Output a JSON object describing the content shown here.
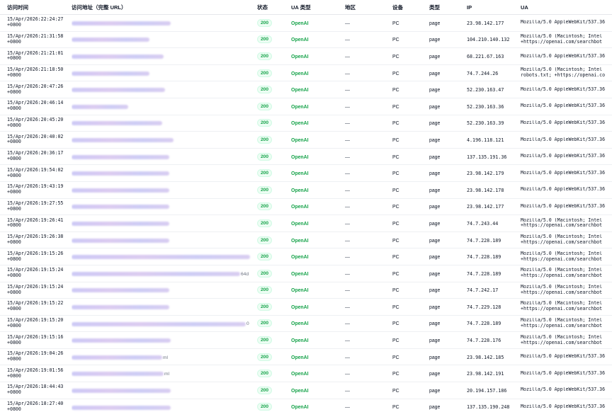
{
  "headers": {
    "time": "访问时间",
    "url": "访问地址（完整 URL）",
    "status": "状态",
    "ua_type": "UA 类型",
    "region": "地区",
    "device": "设备",
    "type": "类型",
    "ip": "IP",
    "ua": "UA"
  },
  "rows": [
    {
      "time1": "15/Apr/2026:22:24:27",
      "time2": "+0800",
      "url_blur_len": 140,
      "url_tail": "",
      "status": "200",
      "ua_type": "OpenAI",
      "region": "—",
      "device": "PC",
      "type": "page",
      "ip": "23.98.142.177",
      "ua1": "Mozilla/5.0 AppleWebKit/537.36",
      "ua2": ""
    },
    {
      "time1": "15/Apr/2026:21:31:58",
      "time2": "+0800",
      "url_blur_len": 110,
      "url_tail": "",
      "status": "200",
      "ua_type": "OpenAI",
      "region": "—",
      "device": "PC",
      "type": "page",
      "ip": "104.210.140.132",
      "ua1": "Mozilla/5.0 (Macintosh; Intel",
      "ua2": "+https://openai.com/searchbot"
    },
    {
      "time1": "15/Apr/2026:21:21:01",
      "time2": "+0800",
      "url_blur_len": 130,
      "url_tail": "",
      "status": "200",
      "ua_type": "OpenAI",
      "region": "—",
      "device": "PC",
      "type": "page",
      "ip": "68.221.67.163",
      "ua1": "Mozilla/5.0 AppleWebKit/537.36",
      "ua2": ""
    },
    {
      "time1": "15/Apr/2026:21:18:50",
      "time2": "+0800",
      "url_blur_len": 110,
      "url_tail": "",
      "status": "200",
      "ua_type": "OpenAI",
      "region": "—",
      "device": "PC",
      "type": "page",
      "ip": "74.7.244.26",
      "ua1": "Mozilla/5.0 (Macintosh; Intel",
      "ua2": "robots.txt; +https://openai.co"
    },
    {
      "time1": "15/Apr/2026:20:47:26",
      "time2": "+0800",
      "url_blur_len": 132,
      "url_tail": "",
      "status": "200",
      "ua_type": "OpenAI",
      "region": "—",
      "device": "PC",
      "type": "page",
      "ip": "52.230.163.47",
      "ua1": "Mozilla/5.0 AppleWebKit/537.36",
      "ua2": ""
    },
    {
      "time1": "15/Apr/2026:20:46:14",
      "time2": "+0800",
      "url_blur_len": 80,
      "url_tail": "",
      "status": "200",
      "ua_type": "OpenAI",
      "region": "—",
      "device": "PC",
      "type": "page",
      "ip": "52.230.163.36",
      "ua1": "Mozilla/5.0 AppleWebKit/537.36",
      "ua2": ""
    },
    {
      "time1": "15/Apr/2026:20:45:20",
      "time2": "+0800",
      "url_blur_len": 128,
      "url_tail": "",
      "status": "200",
      "ua_type": "OpenAI",
      "region": "—",
      "device": "PC",
      "type": "page",
      "ip": "52.230.163.39",
      "ua1": "Mozilla/5.0 AppleWebKit/537.36",
      "ua2": ""
    },
    {
      "time1": "15/Apr/2026:20:40:02",
      "time2": "+0800",
      "url_blur_len": 144,
      "url_tail": "",
      "status": "200",
      "ua_type": "OpenAI",
      "region": "—",
      "device": "PC",
      "type": "page",
      "ip": "4.196.118.121",
      "ua1": "Mozilla/5.0 AppleWebKit/537.36",
      "ua2": ""
    },
    {
      "time1": "15/Apr/2026:20:36:17",
      "time2": "+0800",
      "url_blur_len": 138,
      "url_tail": "",
      "status": "200",
      "ua_type": "OpenAI",
      "region": "—",
      "device": "PC",
      "type": "page",
      "ip": "137.135.191.36",
      "ua1": "Mozilla/5.0 AppleWebKit/537.36",
      "ua2": ""
    },
    {
      "time1": "15/Apr/2026:19:54:02",
      "time2": "+0800",
      "url_blur_len": 138,
      "url_tail": "",
      "status": "200",
      "ua_type": "OpenAI",
      "region": "—",
      "device": "PC",
      "type": "page",
      "ip": "23.98.142.179",
      "ua1": "Mozilla/5.0 AppleWebKit/537.36",
      "ua2": ""
    },
    {
      "time1": "15/Apr/2026:19:43:19",
      "time2": "+0800",
      "url_blur_len": 138,
      "url_tail": "",
      "status": "200",
      "ua_type": "OpenAI",
      "region": "—",
      "device": "PC",
      "type": "page",
      "ip": "23.98.142.178",
      "ua1": "Mozilla/5.0 AppleWebKit/537.36",
      "ua2": ""
    },
    {
      "time1": "15/Apr/2026:19:27:55",
      "time2": "+0800",
      "url_blur_len": 138,
      "url_tail": "",
      "status": "200",
      "ua_type": "OpenAI",
      "region": "—",
      "device": "PC",
      "type": "page",
      "ip": "23.98.142.177",
      "ua1": "Mozilla/5.0 AppleWebKit/537.36",
      "ua2": ""
    },
    {
      "time1": "15/Apr/2026:19:26:41",
      "time2": "+0800",
      "url_blur_len": 138,
      "url_tail": "",
      "status": "200",
      "ua_type": "OpenAI",
      "region": "—",
      "device": "PC",
      "type": "page",
      "ip": "74.7.243.44",
      "ua1": "Mozilla/5.0 (Macintosh; Intel",
      "ua2": "+https://openai.com/searchbot"
    },
    {
      "time1": "15/Apr/2026:19:26:38",
      "time2": "+0800",
      "url_blur_len": 138,
      "url_tail": "",
      "status": "200",
      "ua_type": "OpenAI",
      "region": "—",
      "device": "PC",
      "type": "page",
      "ip": "74.7.228.189",
      "ua1": "Mozilla/5.0 (Macintosh; Intel",
      "ua2": "+https://openai.com/searchbot"
    },
    {
      "time1": "15/Apr/2026:19:15:26",
      "time2": "+0800",
      "url_blur_len": 252,
      "url_tail": "",
      "status": "200",
      "ua_type": "OpenAI",
      "region": "—",
      "device": "PC",
      "type": "page",
      "ip": "74.7.228.189",
      "ua1": "Mozilla/5.0 (Macintosh; Intel",
      "ua2": "+https://openai.com/searchbot"
    },
    {
      "time1": "15/Apr/2026:19:15:24",
      "time2": "+0800",
      "url_blur_len": 238,
      "url_tail": "64d",
      "status": "200",
      "ua_type": "OpenAI",
      "region": "—",
      "device": "PC",
      "type": "page",
      "ip": "74.7.228.189",
      "ua1": "Mozilla/5.0 (Macintosh; Intel",
      "ua2": "+https://openai.com/searchbot"
    },
    {
      "time1": "15/Apr/2026:19:15:24",
      "time2": "+0800",
      "url_blur_len": 138,
      "url_tail": "",
      "status": "200",
      "ua_type": "OpenAI",
      "region": "—",
      "device": "PC",
      "type": "page",
      "ip": "74.7.242.17",
      "ua1": "Mozilla/5.0 (Macintosh; Intel",
      "ua2": "+https://openai.com/searchbot"
    },
    {
      "time1": "15/Apr/2026:19:15:22",
      "time2": "+0800",
      "url_blur_len": 138,
      "url_tail": "",
      "status": "200",
      "ua_type": "OpenAI",
      "region": "—",
      "device": "PC",
      "type": "page",
      "ip": "74.7.229.128",
      "ua1": "Mozilla/5.0 (Macintosh; Intel",
      "ua2": "+https://openai.com/searchbot"
    },
    {
      "time1": "15/Apr/2026:19:15:20",
      "time2": "+0800",
      "url_blur_len": 246,
      "url_tail": "0",
      "status": "200",
      "ua_type": "OpenAI",
      "region": "—",
      "device": "PC",
      "type": "page",
      "ip": "74.7.228.189",
      "ua1": "Mozilla/5.0 (Macintosh; Intel",
      "ua2": "+https://openai.com/searchbot"
    },
    {
      "time1": "15/Apr/2026:19:15:16",
      "time2": "+0800",
      "url_blur_len": 140,
      "url_tail": "",
      "status": "200",
      "ua_type": "OpenAI",
      "region": "—",
      "device": "PC",
      "type": "page",
      "ip": "74.7.228.176",
      "ua1": "Mozilla/5.0 (Macintosh; Intel",
      "ua2": "+https://openai.com/searchbot"
    },
    {
      "time1": "15/Apr/2026:19:04:26",
      "time2": "+0800",
      "url_blur_len": 128,
      "url_tail": "ml",
      "status": "200",
      "ua_type": "OpenAI",
      "region": "—",
      "device": "PC",
      "type": "page",
      "ip": "23.98.142.185",
      "ua1": "Mozilla/5.0 AppleWebKit/537.36",
      "ua2": ""
    },
    {
      "time1": "15/Apr/2026:19:01:56",
      "time2": "+0800",
      "url_blur_len": 130,
      "url_tail": "ml",
      "status": "200",
      "ua_type": "OpenAI",
      "region": "—",
      "device": "PC",
      "type": "page",
      "ip": "23.98.142.191",
      "ua1": "Mozilla/5.0 AppleWebKit/537.36",
      "ua2": ""
    },
    {
      "time1": "15/Apr/2026:18:44:43",
      "time2": "+0800",
      "url_blur_len": 140,
      "url_tail": "",
      "status": "200",
      "ua_type": "OpenAI",
      "region": "—",
      "device": "PC",
      "type": "page",
      "ip": "20.194.157.186",
      "ua1": "Mozilla/5.0 AppleWebKit/537.36",
      "ua2": ""
    },
    {
      "time1": "15/Apr/2026:18:27:40",
      "time2": "+0800",
      "url_blur_len": 140,
      "url_tail": "",
      "status": "200",
      "ua_type": "OpenAI",
      "region": "—",
      "device": "PC",
      "type": "page",
      "ip": "137.135.190.248",
      "ua1": "Mozilla/5.0 AppleWebKit/537.36",
      "ua2": ""
    }
  ]
}
